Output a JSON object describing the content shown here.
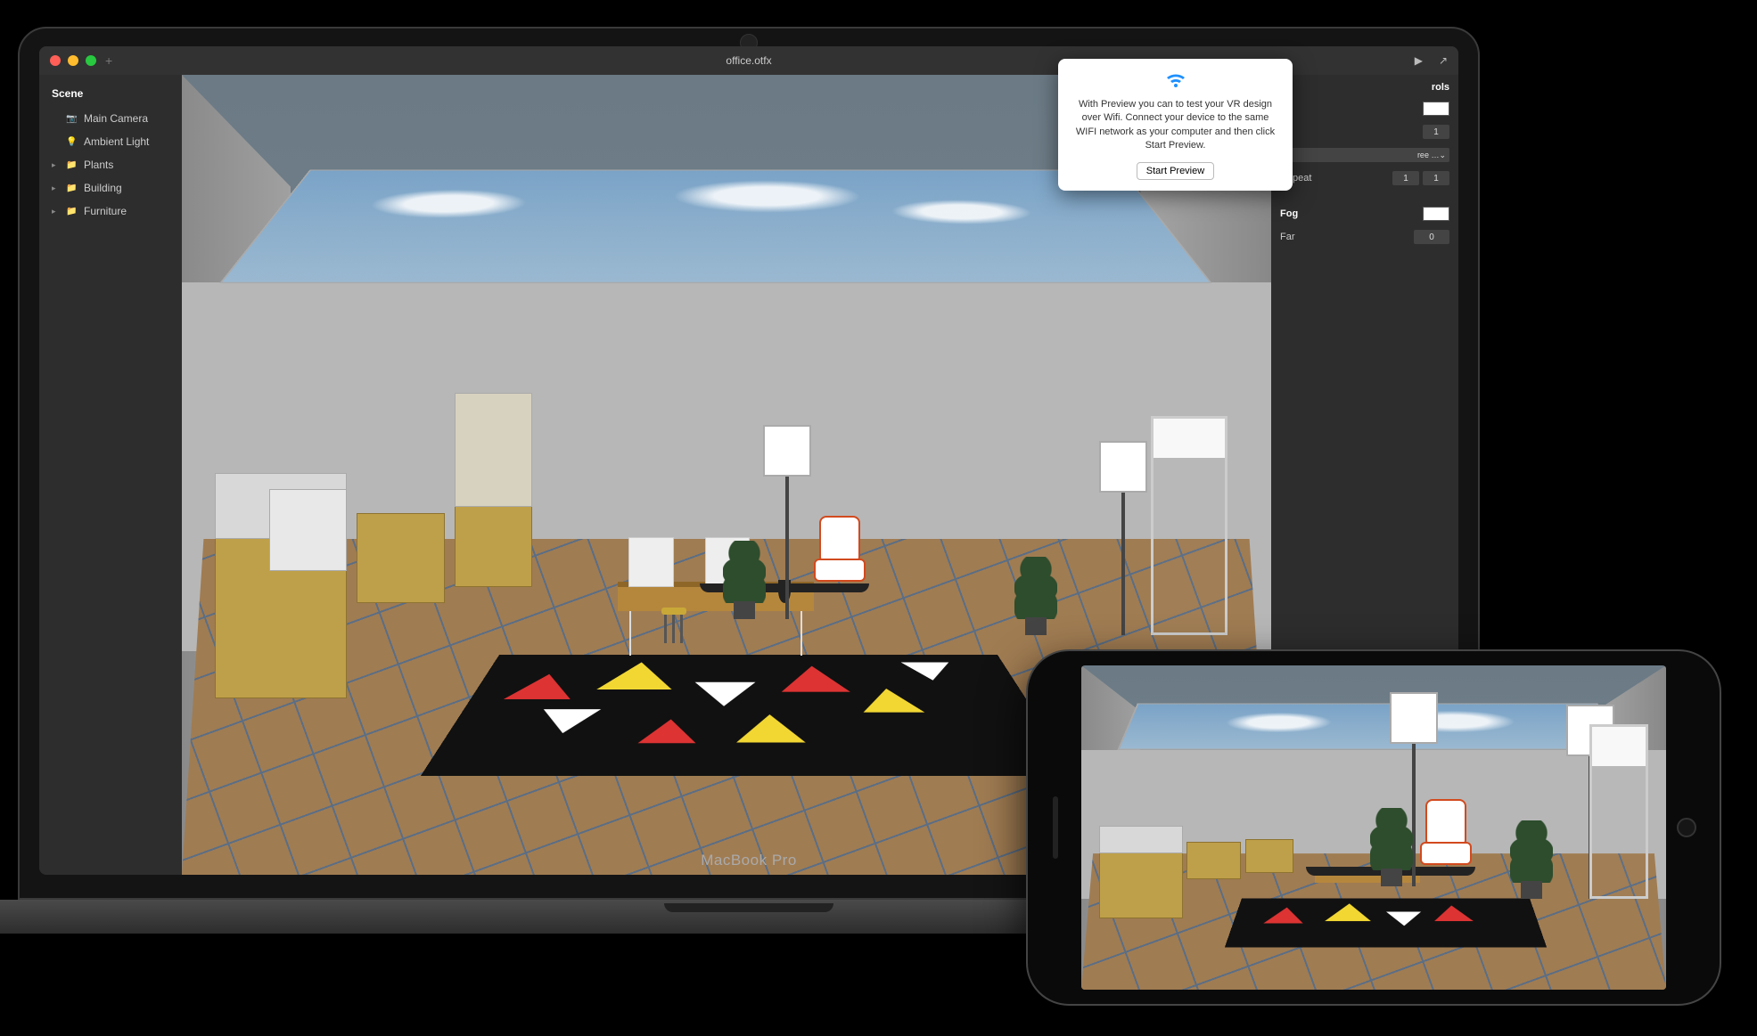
{
  "window": {
    "title": "office.otfx",
    "device_label": "MacBook Pro",
    "traffic": {
      "close": "close",
      "minimize": "minimize",
      "zoom": "zoom"
    },
    "plus_label": "+",
    "play_glyph": "▶",
    "share_glyph": "↗"
  },
  "sidebar": {
    "heading": "Scene",
    "items": [
      {
        "icon": "📷",
        "label": "Main Camera",
        "expandable": false
      },
      {
        "icon": "💡",
        "label": "Ambient Light",
        "expandable": false
      },
      {
        "icon": "📁",
        "label": "Plants",
        "expandable": true
      },
      {
        "icon": "📁",
        "label": "Building",
        "expandable": true
      },
      {
        "icon": "📁",
        "label": "Furniture",
        "expandable": true
      }
    ]
  },
  "inspector": {
    "header_partial": "rols",
    "row_count_value": "1",
    "wrap_label_partial": "ree …",
    "repeat_label": "Repeat",
    "repeat_x": "1",
    "repeat_y": "1",
    "fog_label": "Fog",
    "far_label": "Far",
    "far_value": "0",
    "swatch_color": "#ffffff"
  },
  "popover": {
    "text": "With Preview you can to test your VR design over Wifi. Connect your device to the same WIFI network as your computer and then click Start Preview.",
    "button": "Start Preview"
  },
  "scene": {
    "description": "3D office interior render: skylight ceiling with clouds, grey walls, wooden gridded floor, geometric black rug with red/yellow/white triangles, wood cabinets along left wall, desk with vintage computers, yellow stool, orange-trimmed lounge chair, two floor lamps, potted plants, white open shelving unit on right."
  }
}
